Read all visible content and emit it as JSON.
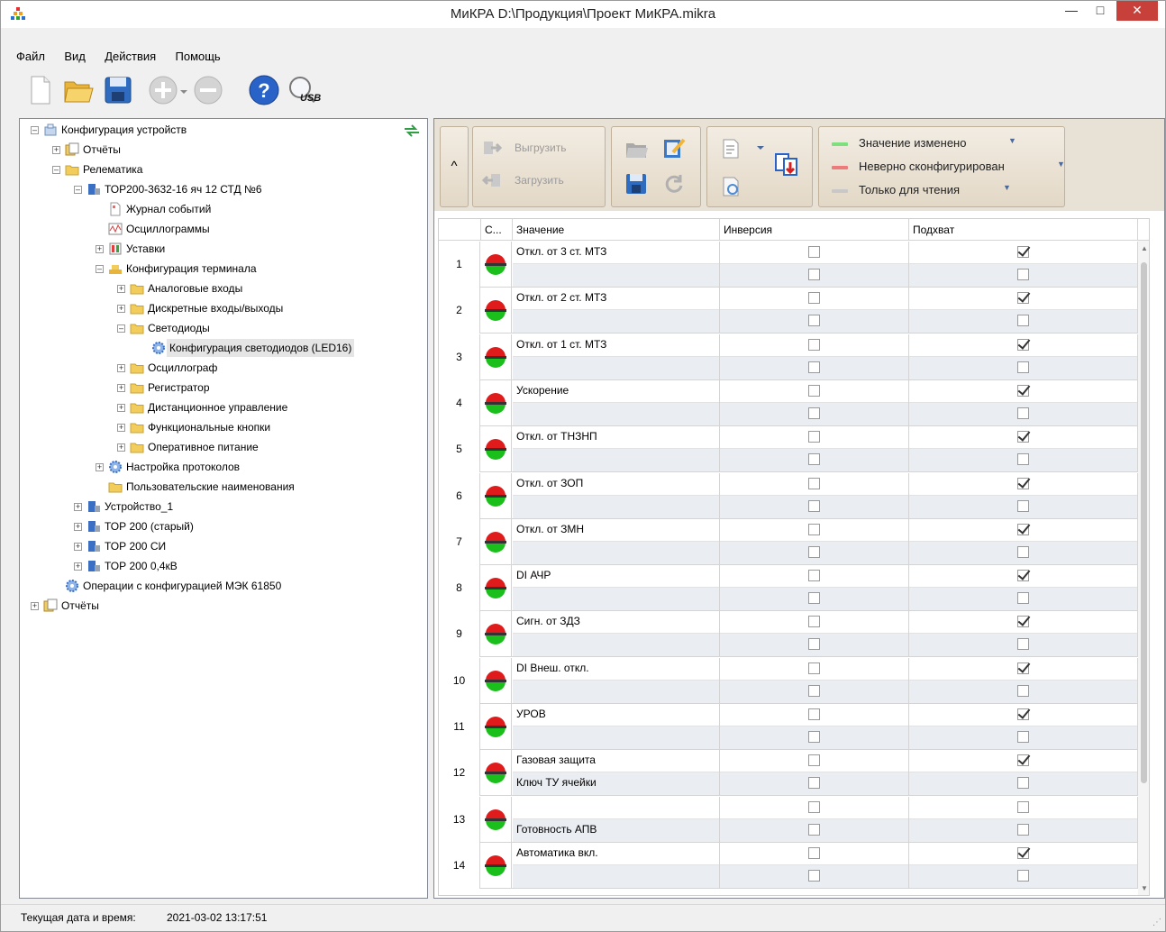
{
  "window": {
    "title": "МиКРА D:\\Продукция\\Проект МиКРА.mikra"
  },
  "menu": [
    "Файл",
    "Вид",
    "Действия",
    "Помощь"
  ],
  "toolbar": {
    "usb_label": "USB"
  },
  "tree": [
    {
      "label": "Конфигурация устройств",
      "level": 0,
      "exp": "minus",
      "icon": "devices"
    },
    {
      "label": "Отчёты",
      "level": 1,
      "exp": "plus",
      "icon": "reports"
    },
    {
      "label": "Релематика",
      "level": 1,
      "exp": "minus",
      "icon": "folder"
    },
    {
      "label": "ТОР200-3632-16 яч 12 СТД №6",
      "level": 2,
      "exp": "minus",
      "icon": "device"
    },
    {
      "label": "Журнал событий",
      "level": 3,
      "exp": "none",
      "icon": "doc"
    },
    {
      "label": "Осциллограммы",
      "level": 3,
      "exp": "none",
      "icon": "osc"
    },
    {
      "label": "Уставки",
      "level": 3,
      "exp": "plus",
      "icon": "settings"
    },
    {
      "label": "Конфигурация терминала",
      "level": 3,
      "exp": "minus",
      "icon": "terminal"
    },
    {
      "label": "Аналоговые входы",
      "level": 4,
      "exp": "plus",
      "icon": "folder"
    },
    {
      "label": "Дискретные входы/выходы",
      "level": 4,
      "exp": "plus",
      "icon": "folder"
    },
    {
      "label": "Светодиоды",
      "level": 4,
      "exp": "minus",
      "icon": "folder"
    },
    {
      "label": "Конфигурация светодиодов (LED16)",
      "level": 5,
      "exp": "none",
      "icon": "gear",
      "selected": true
    },
    {
      "label": "Осциллограф",
      "level": 4,
      "exp": "plus",
      "icon": "folder"
    },
    {
      "label": "Регистратор",
      "level": 4,
      "exp": "plus",
      "icon": "folder"
    },
    {
      "label": "Дистанционное управление",
      "level": 4,
      "exp": "plus",
      "icon": "folder"
    },
    {
      "label": "Функциональные кнопки",
      "level": 4,
      "exp": "plus",
      "icon": "folder"
    },
    {
      "label": "Оперативное питание",
      "level": 4,
      "exp": "plus",
      "icon": "folder"
    },
    {
      "label": "Настройка протоколов",
      "level": 3,
      "exp": "plus",
      "icon": "gear"
    },
    {
      "label": "Пользовательские наименования",
      "level": 3,
      "exp": "none",
      "icon": "folder"
    },
    {
      "label": "Устройство_1",
      "level": 2,
      "exp": "plus",
      "icon": "device"
    },
    {
      "label": "ТОР 200 (старый)",
      "level": 2,
      "exp": "plus",
      "icon": "device"
    },
    {
      "label": "ТОР 200 СИ",
      "level": 2,
      "exp": "plus",
      "icon": "device"
    },
    {
      "label": "ТОР 200 0,4кВ",
      "level": 2,
      "exp": "plus",
      "icon": "device"
    },
    {
      "label": "Операции с конфигурацией МЭК 61850",
      "level": 1,
      "exp": "none",
      "icon": "gear"
    },
    {
      "label": "Отчёты",
      "level": 0,
      "exp": "plus",
      "icon": "reports"
    }
  ],
  "ribbon": {
    "collapse_symbol": "^",
    "upload_label": "Выгрузить",
    "download_label": "Загрузить",
    "legend": [
      {
        "label": "Значение изменено",
        "color": "#7ddf7d"
      },
      {
        "label": "Неверно сконфигурирован",
        "color": "#ee7b7b"
      },
      {
        "label": "Только для чтения",
        "color": "#c8c8c8"
      }
    ]
  },
  "grid": {
    "columns": {
      "state": "С...",
      "value": "Значение",
      "inversion": "Инверсия",
      "capture": "Подхват"
    },
    "rows": [
      {
        "num": "1",
        "top": {
          "text": "Откл. от 3 ст. МТЗ",
          "inv": false,
          "cap": true
        },
        "bot": {
          "text": "",
          "inv": false,
          "cap": false
        }
      },
      {
        "num": "2",
        "top": {
          "text": "Откл. от 2 ст. МТЗ",
          "inv": false,
          "cap": true
        },
        "bot": {
          "text": "",
          "inv": false,
          "cap": false
        }
      },
      {
        "num": "3",
        "top": {
          "text": "Откл. от 1 ст. МТЗ",
          "inv": false,
          "cap": true
        },
        "bot": {
          "text": "",
          "inv": false,
          "cap": false
        }
      },
      {
        "num": "4",
        "top": {
          "text": "Ускорение",
          "inv": false,
          "cap": true
        },
        "bot": {
          "text": "",
          "inv": false,
          "cap": false
        }
      },
      {
        "num": "5",
        "top": {
          "text": "Откл. от ТНЗНП",
          "inv": false,
          "cap": true
        },
        "bot": {
          "text": "",
          "inv": false,
          "cap": false
        }
      },
      {
        "num": "6",
        "top": {
          "text": "Откл. от ЗОП",
          "inv": false,
          "cap": true
        },
        "bot": {
          "text": "",
          "inv": false,
          "cap": false
        }
      },
      {
        "num": "7",
        "top": {
          "text": "Откл. от ЗМН",
          "inv": false,
          "cap": true
        },
        "bot": {
          "text": "",
          "inv": false,
          "cap": false
        }
      },
      {
        "num": "8",
        "top": {
          "text": "DI АЧР",
          "inv": false,
          "cap": true
        },
        "bot": {
          "text": "",
          "inv": false,
          "cap": false
        }
      },
      {
        "num": "9",
        "top": {
          "text": "Сигн. от ЗДЗ",
          "inv": false,
          "cap": true
        },
        "bot": {
          "text": "",
          "inv": false,
          "cap": false
        }
      },
      {
        "num": "10",
        "top": {
          "text": "DI Внеш. откл.",
          "inv": false,
          "cap": true
        },
        "bot": {
          "text": "",
          "inv": false,
          "cap": false
        }
      },
      {
        "num": "11",
        "top": {
          "text": "УРОВ",
          "inv": false,
          "cap": true
        },
        "bot": {
          "text": "",
          "inv": false,
          "cap": false
        }
      },
      {
        "num": "12",
        "top": {
          "text": "Газовая защита",
          "inv": false,
          "cap": true
        },
        "bot": {
          "text": "Ключ ТУ ячейки",
          "inv": false,
          "cap": false
        }
      },
      {
        "num": "13",
        "top": {
          "text": "",
          "inv": false,
          "cap": false
        },
        "bot": {
          "text": "Готовность АПВ",
          "inv": false,
          "cap": false
        }
      },
      {
        "num": "14",
        "top": {
          "text": "Автоматика вкл.",
          "inv": false,
          "cap": true
        },
        "bot": {
          "text": "",
          "inv": false,
          "cap": false
        }
      }
    ]
  },
  "status": {
    "label": "Текущая дата и время:",
    "value": "2021-03-02 13:17:51"
  }
}
